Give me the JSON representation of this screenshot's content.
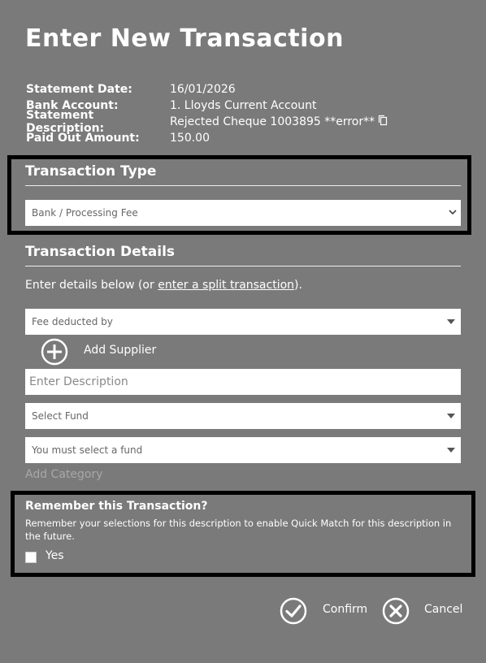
{
  "page": {
    "title": "Enter New Transaction"
  },
  "statement": {
    "rows": [
      {
        "label": "Statement Date:",
        "value": "16/01/2026"
      },
      {
        "label": "Bank Account:",
        "value": "1. Lloyds Current Account"
      },
      {
        "label": "Statement Description:",
        "value": "Rejected Cheque 1003895 **error**"
      },
      {
        "label": "Paid Out Amount:",
        "value": "150.00"
      }
    ],
    "copy_icon": "copy-icon"
  },
  "transaction_type": {
    "heading": "Transaction Type",
    "selected": "Bank / Processing Fee"
  },
  "transaction_details": {
    "heading": "Transaction Details",
    "intro_prefix": "Enter details below (or ",
    "split_link": "enter a split transaction",
    "intro_suffix": ").",
    "fee_deducted_by": "Fee deducted by",
    "add_supplier_label": "Add Supplier",
    "description_placeholder": "Enter Description",
    "select_fund": "Select Fund",
    "category_placeholder": "You must select a fund",
    "add_category": "Add Category"
  },
  "remember": {
    "title": "Remember this Transaction?",
    "text": "Remember your selections for this description to enable Quick Match for this description in the future.",
    "yes_label": "Yes"
  },
  "actions": {
    "confirm": "Confirm",
    "cancel": "Cancel"
  }
}
